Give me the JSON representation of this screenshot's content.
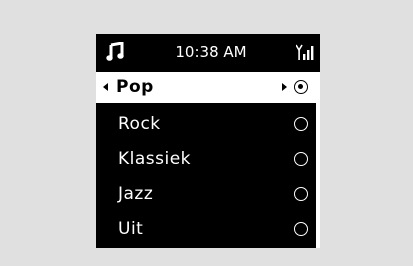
{
  "status_bar": {
    "time": "10:38 AM",
    "left_icon": "music-note-icon",
    "right_icon": "signal-strength-icon"
  },
  "menu": {
    "items": [
      {
        "label": "Pop",
        "selected": true
      },
      {
        "label": "Rock",
        "selected": false
      },
      {
        "label": "Klassiek",
        "selected": false
      },
      {
        "label": "Jazz",
        "selected": false
      },
      {
        "label": "Uit",
        "selected": false
      }
    ]
  },
  "colors": {
    "background": "#e0e0e0",
    "screen": "#000000",
    "highlight": "#ffffff"
  }
}
